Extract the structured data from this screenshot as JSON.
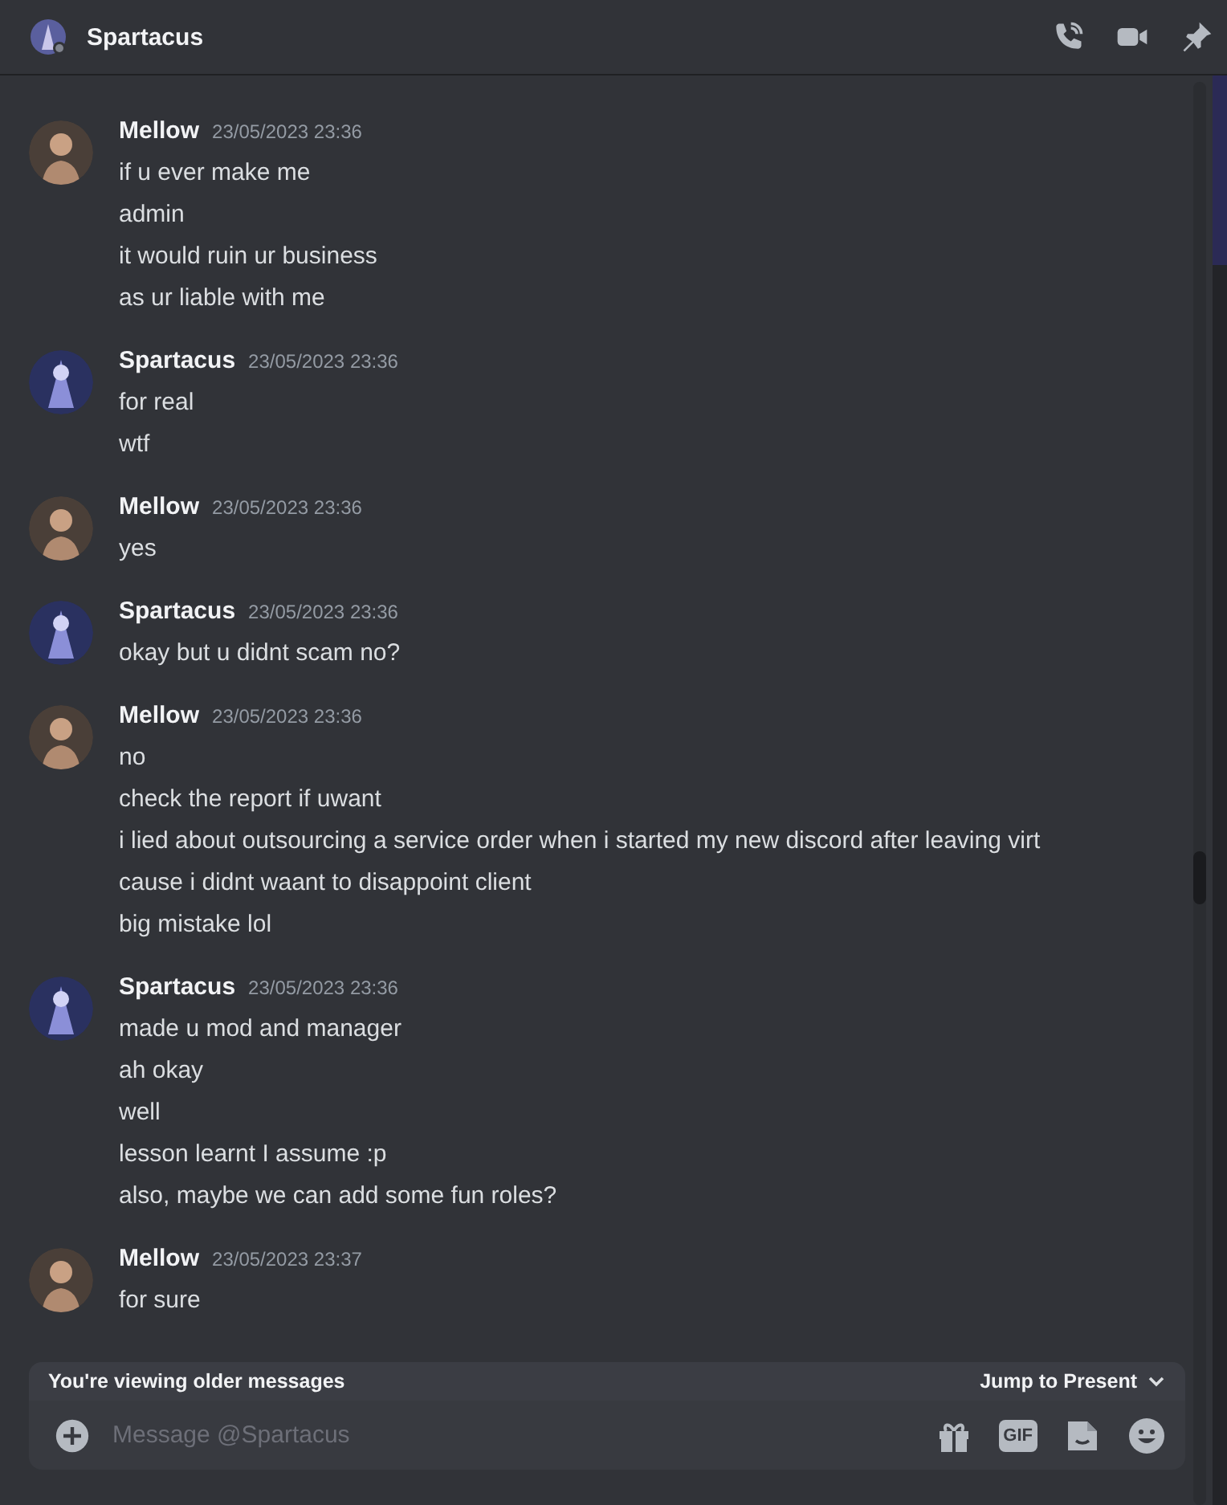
{
  "header": {
    "title": "Spartacus"
  },
  "messages": [
    {
      "author": "Mellow",
      "kind": "mellow",
      "time": "23/05/2023 23:36",
      "lines": [
        "if u ever make me",
        "admin",
        "it would ruin ur business",
        "as ur liable with me"
      ]
    },
    {
      "author": "Spartacus",
      "kind": "spartacus",
      "time": "23/05/2023 23:36",
      "lines": [
        "for real",
        "wtf"
      ]
    },
    {
      "author": "Mellow",
      "kind": "mellow",
      "time": "23/05/2023 23:36",
      "lines": [
        "yes"
      ]
    },
    {
      "author": "Spartacus",
      "kind": "spartacus",
      "time": "23/05/2023 23:36",
      "lines": [
        "okay but u didnt scam no?"
      ]
    },
    {
      "author": "Mellow",
      "kind": "mellow",
      "time": "23/05/2023 23:36",
      "lines": [
        "no",
        "check the report if uwant",
        "i lied about outsourcing a service order when i started my new discord after leaving virt",
        "cause i didnt waant to disappoint client",
        "big mistake lol"
      ]
    },
    {
      "author": "Spartacus",
      "kind": "spartacus",
      "time": "23/05/2023 23:36",
      "lines": [
        "made u mod and manager",
        "ah okay",
        "well",
        "lesson learnt I assume :p",
        "also, maybe we can add some fun roles?"
      ]
    },
    {
      "author": "Mellow",
      "kind": "mellow",
      "time": "23/05/2023 23:37",
      "lines": [
        "for sure"
      ]
    }
  ],
  "banner": {
    "text": "You're viewing older messages",
    "action": "Jump to Present"
  },
  "composer": {
    "placeholder": "Message @Spartacus",
    "gif": "GIF"
  }
}
